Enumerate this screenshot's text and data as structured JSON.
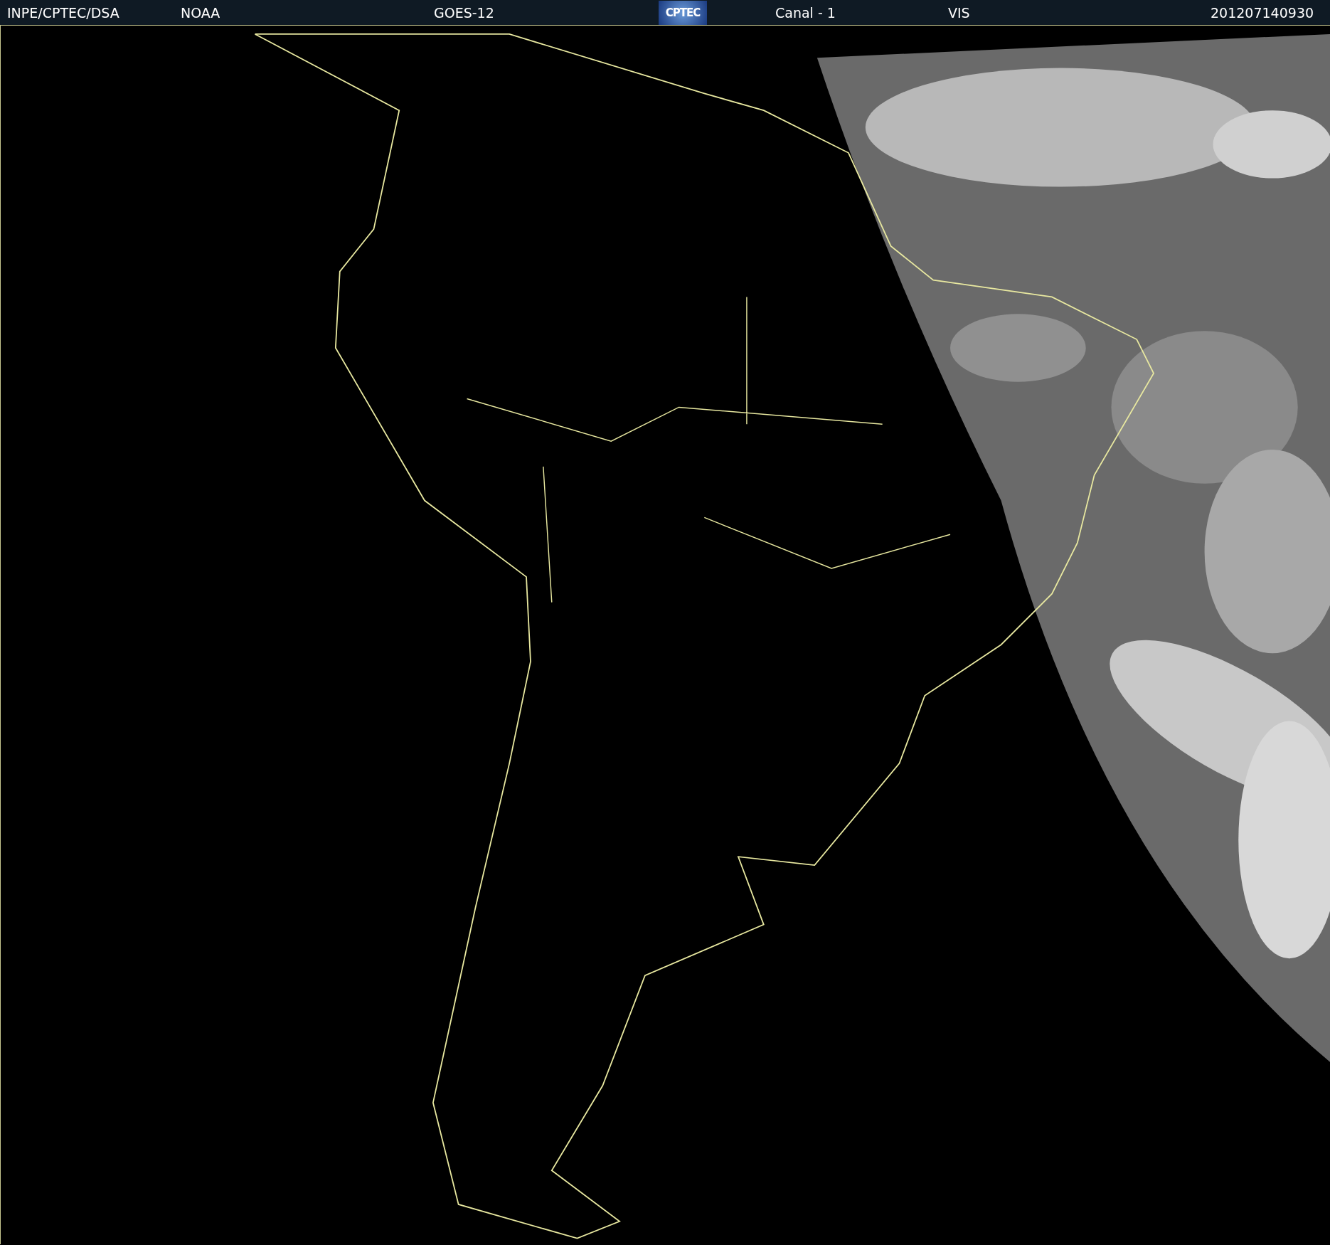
{
  "header": {
    "items": [
      {
        "kind": "text",
        "text": "INPE/CPTEC/DSA"
      },
      {
        "kind": "text",
        "text": "NOAA"
      },
      {
        "kind": "text",
        "text": "GOES-12"
      },
      {
        "kind": "logo",
        "text": "CPTEC"
      },
      {
        "kind": "text",
        "text": "Canal - 1"
      },
      {
        "kind": "text",
        "text": "VIS"
      },
      {
        "kind": "text",
        "text": "201207140930"
      }
    ]
  }
}
